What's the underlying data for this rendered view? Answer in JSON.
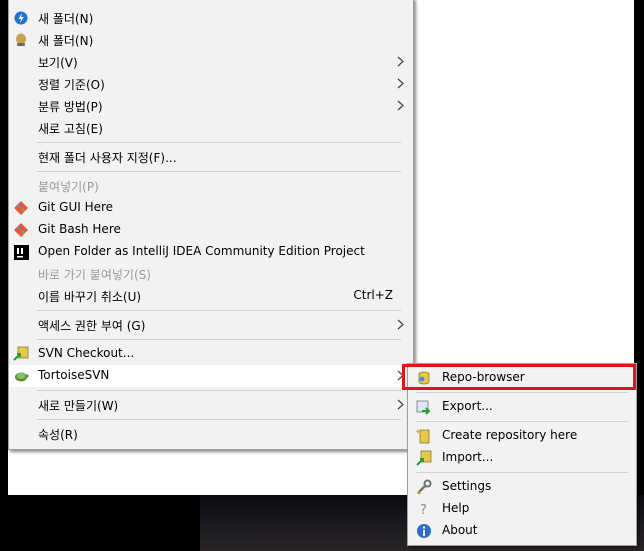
{
  "main_menu": {
    "items": [
      {
        "label": "새 폴더(N)",
        "icon": "blue-new-folder-icon"
      },
      {
        "label": "새 폴더(N)",
        "icon": "gold-new-folder-icon"
      },
      {
        "label": "보기(V)",
        "submenu": true
      },
      {
        "label": "정렬 기준(O)",
        "submenu": true
      },
      {
        "label": "분류 방법(P)",
        "submenu": true
      },
      {
        "label": "새로 고침(E)"
      },
      {
        "label": "현재 폴더 사용자 지정(F)..."
      },
      {
        "label": "붙여넣기(P)",
        "disabled": true
      },
      {
        "label": "Git GUI Here",
        "icon": "git-icon"
      },
      {
        "label": "Git Bash Here",
        "icon": "git-icon"
      },
      {
        "label": "Open Folder as IntelliJ IDEA Community Edition Project",
        "icon": "intellij-icon"
      },
      {
        "label": "바로 가기 붙여넣기(S)",
        "disabled": true
      },
      {
        "label": "이름 바꾸기 취소(U)",
        "shortcut": "Ctrl+Z"
      },
      {
        "label": "액세스 권한 부여 (G)",
        "submenu": true
      },
      {
        "label": "SVN Checkout...",
        "icon": "svn-checkout-icon"
      },
      {
        "label": "TortoiseSVN",
        "icon": "tortoise-icon",
        "submenu": true
      },
      {
        "label": "새로 만들기(W)",
        "submenu": true
      },
      {
        "label": "속성(R)"
      }
    ]
  },
  "sub_menu": {
    "items": [
      {
        "label": "Repo-browser",
        "icon": "repo-browser-icon"
      },
      {
        "label": "Export...",
        "icon": "export-icon"
      },
      {
        "label": "Create repository here",
        "icon": "create-repo-icon"
      },
      {
        "label": "Import...",
        "icon": "import-icon"
      },
      {
        "label": "Settings",
        "icon": "settings-icon"
      },
      {
        "label": "Help",
        "icon": "help-icon"
      },
      {
        "label": "About",
        "icon": "about-icon"
      }
    ]
  },
  "colors": {
    "menu_bg": "#f2f2f2",
    "highlight": "#e3141c",
    "disabled": "#9a9a9a"
  }
}
